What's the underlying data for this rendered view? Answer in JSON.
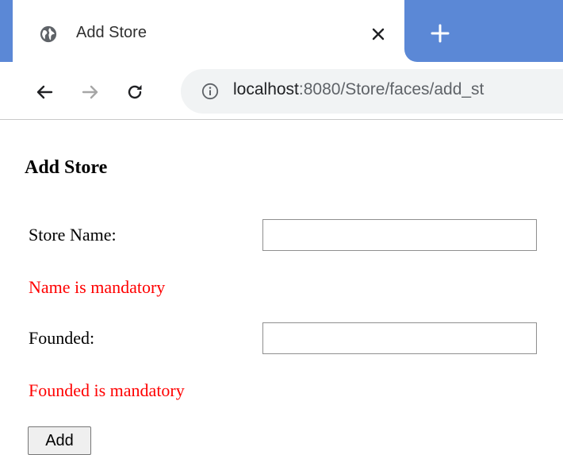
{
  "browser": {
    "tab": {
      "title": "Add Store",
      "favicon": "globe-icon",
      "close_icon": "close-icon"
    },
    "new_tab_icon": "plus-icon",
    "nav": {
      "back_icon": "arrow-left-icon",
      "forward_icon": "arrow-right-icon",
      "reload_icon": "reload-icon"
    },
    "address_bar": {
      "info_icon": "info-icon",
      "host": "localhost",
      "path": ":8080/Store/faces/add_st"
    },
    "colors": {
      "tabstrip": "#5b88d6",
      "omnibox": "#f1f3f4"
    }
  },
  "page": {
    "title": "Add Store",
    "form": {
      "name_label": "Store Name:",
      "name_value": "",
      "name_error": "Name is mandatory",
      "founded_label": "Founded:",
      "founded_value": "",
      "founded_error": "Founded is mandatory",
      "submit_label": "Add"
    },
    "colors": {
      "error": "#ff0000"
    }
  }
}
